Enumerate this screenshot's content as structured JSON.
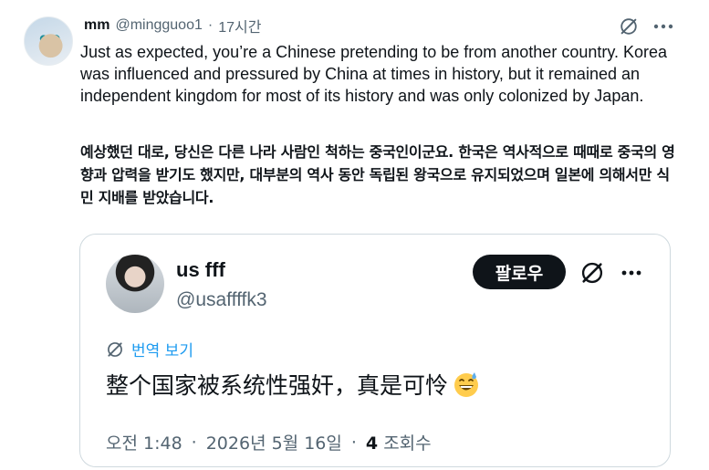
{
  "post": {
    "author_name": "mm",
    "author_handle": "@mingguoo1",
    "separator": "·",
    "time_ago": "17시간",
    "text_en": "Just as expected, you’re a Chinese pretending to be from another country. Korea was influenced and pressured by China at times in history, but it remained an independent kingdom for most of its history and was only colonized by Japan.",
    "text_ko": "예상했던 대로, 당신은 다른 나라 사람인 척하는 중국인이군요. 한국은 역사적으로 때때로 중국의 영향과 압력을 받기도 했지만, 대부분의 역사 동안 독립된 왕국으로 유지되었으며 일본에 의해서만 식민 지배를 받았습니다."
  },
  "quote": {
    "name": "us fff",
    "handle": "@usaffffk3",
    "follow_label": "팔로우",
    "translate_label": "번역 보기",
    "text": "整个国家被系统性强奸，真是可怜",
    "time": "오전 1:48",
    "date": "2026년 5월 16일",
    "dot": "·",
    "views_count": "4",
    "views_label": "조회수"
  },
  "icons": {
    "grok": "grok-icon",
    "more": "more-icon",
    "translate": "translate-globe-icon",
    "emoji": "grinning-sweat-emoji-icon"
  },
  "colors": {
    "link_blue": "#1d9bf0",
    "text_primary": "#0f1419",
    "text_secondary": "#536471",
    "border": "#cfd9de"
  }
}
